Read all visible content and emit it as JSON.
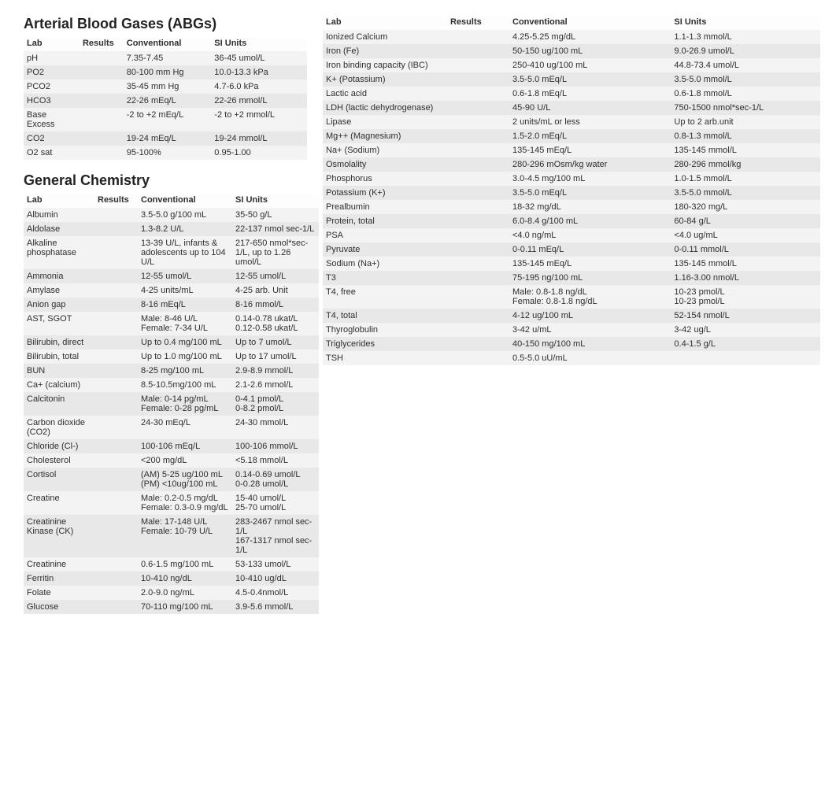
{
  "headers": {
    "lab": "Lab",
    "results": "Results",
    "conventional": "Conventional",
    "si": "SI Units"
  },
  "abg": {
    "title": "Arterial Blood Gases (ABGs)",
    "rows": [
      {
        "lab": "pH",
        "res": "",
        "conv": "7.35-7.45",
        "si": "36-45 umol/L"
      },
      {
        "lab": "PO2",
        "res": "",
        "conv": "80-100 mm Hg",
        "si": "10.0-13.3 kPa"
      },
      {
        "lab": "PCO2",
        "res": "",
        "conv": "35-45 mm Hg",
        "si": "4.7-6.0 kPa"
      },
      {
        "lab": "HCO3",
        "res": "",
        "conv": "22-26 mEq/L",
        "si": "22-26 mmol/L"
      },
      {
        "lab": "Base Excess",
        "res": "",
        "conv": "-2 to +2 mEq/L",
        "si": "-2 to +2 mmol/L"
      },
      {
        "lab": "CO2",
        "res": "",
        "conv": "19-24 mEq/L",
        "si": "19-24 mmol/L"
      },
      {
        "lab": "O2 sat",
        "res": "",
        "conv": "95-100%",
        "si": "0.95-1.00"
      }
    ]
  },
  "gc": {
    "title": "General Chemistry",
    "left_rows": [
      {
        "lab": "Albumin",
        "res": "",
        "conv": "3.5-5.0 g/100 mL",
        "si": "35-50 g/L"
      },
      {
        "lab": "Aldolase",
        "res": "",
        "conv": "1.3-8.2 U/L",
        "si": "22-137 nmol sec-1/L"
      },
      {
        "lab": "Alkaline phosphatase",
        "res": "",
        "conv": "13-39 U/L, infants & adolescents up to 104 U/L",
        "si": "217-650 nmol*sec-1/L, up to 1.26 umol/L"
      },
      {
        "lab": "Ammonia",
        "res": "",
        "conv": "12-55 umol/L",
        "si": "12-55 umol/L"
      },
      {
        "lab": "Amylase",
        "res": "",
        "conv": "4-25 units/mL",
        "si": "4-25 arb. Unit"
      },
      {
        "lab": "Anion gap",
        "res": "",
        "conv": "8-16 mEq/L",
        "si": "8-16 mmol/L"
      },
      {
        "lab": "AST, SGOT",
        "res": "",
        "conv": "Male: 8-46 U/L\nFemale: 7-34 U/L",
        "si": "0.14-0.78 ukat/L\n0.12-0.58 ukat/L"
      },
      {
        "lab": "Bilirubin, direct",
        "res": "",
        "conv": "Up to 0.4 mg/100 mL",
        "si": "Up to 7 umol/L"
      },
      {
        "lab": "Bilirubin, total",
        "res": "",
        "conv": "Up to 1.0 mg/100 mL",
        "si": "Up to 17 umol/L"
      },
      {
        "lab": "BUN",
        "res": "",
        "conv": "8-25 mg/100 mL",
        "si": "2.9-8.9 mmol/L"
      },
      {
        "lab": "Ca+ (calcium)",
        "res": "",
        "conv": "8.5-10.5mg/100 mL",
        "si": "2.1-2.6 mmol/L"
      },
      {
        "lab": "Calcitonin",
        "res": "",
        "conv": "Male: 0-14 pg/mL\nFemale: 0-28 pg/mL",
        "si": "0-4.1 pmol/L\n0-8.2 pmol/L"
      },
      {
        "lab": "Carbon dioxide (CO2)",
        "res": "",
        "conv": "24-30 mEq/L",
        "si": "24-30 mmol/L"
      },
      {
        "lab": "Chloride (Cl-)",
        "res": "",
        "conv": "100-106 mEq/L",
        "si": "100-106 mmol/L"
      },
      {
        "lab": "Cholesterol",
        "res": "",
        "conv": "<200 mg/dL",
        "si": "<5.18 mmol/L"
      },
      {
        "lab": "Cortisol",
        "res": "",
        "conv": "(AM) 5-25 ug/100 mL\n(PM) <10ug/100 mL",
        "si": "0.14-0.69 umol/L\n0-0.28 umol/L"
      },
      {
        "lab": "Creatine",
        "res": "",
        "conv": "Male: 0.2-0.5 mg/dL\nFemale: 0.3-0.9 mg/dL",
        "si": "15-40 umol/L\n25-70 umol/L"
      },
      {
        "lab": "Creatinine Kinase (CK)",
        "res": "",
        "conv": "Male: 17-148 U/L\nFemale: 10-79 U/L",
        "si": "283-2467 nmol sec-1/L\n167-1317 nmol sec-1/L"
      },
      {
        "lab": "Creatinine",
        "res": "",
        "conv": "0.6-1.5 mg/100 mL",
        "si": "53-133 umol/L"
      },
      {
        "lab": "Ferritin",
        "res": "",
        "conv": "10-410 ng/dL",
        "si": "10-410 ug/dL"
      },
      {
        "lab": "Folate",
        "res": "",
        "conv": "2.0-9.0 ng/mL",
        "si": "4.5-0.4nmol/L"
      },
      {
        "lab": "Glucose",
        "res": "",
        "conv": "70-110 mg/100 mL",
        "si": "3.9-5.6 mmol/L"
      }
    ],
    "right_rows": [
      {
        "lab": "Ionized Calcium",
        "res": "",
        "conv": "4.25-5.25 mg/dL",
        "si": "1.1-1.3 mmol/L"
      },
      {
        "lab": "Iron (Fe)",
        "res": "",
        "conv": "50-150 ug/100 mL",
        "si": "9.0-26.9 umol/L"
      },
      {
        "lab": "Iron binding capacity (IBC)",
        "res": "",
        "conv": "250-410 ug/100 mL",
        "si": "44.8-73.4 umol/L"
      },
      {
        "lab": "K+ (Potassium)",
        "res": "",
        "conv": "3.5-5.0 mEq/L",
        "si": "3.5-5.0 mmol/L"
      },
      {
        "lab": "Lactic acid",
        "res": "",
        "conv": "0.6-1.8 mEq/L",
        "si": "0.6-1.8 mmol/L"
      },
      {
        "lab": "LDH (lactic dehydrogenase)",
        "res": "",
        "conv": "45-90 U/L",
        "si": "750-1500 nmol*sec-1/L"
      },
      {
        "lab": "Lipase",
        "res": "",
        "conv": "2 units/mL or less",
        "si": "Up to 2 arb.unit"
      },
      {
        "lab": "Mg++ (Magnesium)",
        "res": "",
        "conv": "1.5-2.0 mEq/L",
        "si": "0.8-1.3 mmol/L"
      },
      {
        "lab": "Na+ (Sodium)",
        "res": "",
        "conv": "135-145 mEq/L",
        "si": "135-145 mmol/L"
      },
      {
        "lab": "Osmolality",
        "res": "",
        "conv": "280-296 mOsm/kg water",
        "si": "280-296 mmol/kg"
      },
      {
        "lab": "Phosphorus",
        "res": "",
        "conv": "3.0-4.5 mg/100 mL",
        "si": "1.0-1.5 mmol/L"
      },
      {
        "lab": "Potassium (K+)",
        "res": "",
        "conv": "3.5-5.0 mEq/L",
        "si": "3.5-5.0 mmol/L"
      },
      {
        "lab": "Prealbumin",
        "res": "",
        "conv": "18-32 mg/dL",
        "si": "180-320 mg/L"
      },
      {
        "lab": "Protein, total",
        "res": "",
        "conv": "6.0-8.4 g/100 mL",
        "si": "60-84 g/L"
      },
      {
        "lab": "PSA",
        "res": "",
        "conv": "<4.0 ng/mL",
        "si": "<4.0 ug/mL"
      },
      {
        "lab": "Pyruvate",
        "res": "",
        "conv": "0-0.11 mEq/L",
        "si": "0-0.11 mmol/L"
      },
      {
        "lab": "Sodium (Na+)",
        "res": "",
        "conv": "135-145 mEq/L",
        "si": "135-145 mmol/L"
      },
      {
        "lab": "T3",
        "res": "",
        "conv": "75-195 ng/100 mL",
        "si": "1.16-3.00 nmol/L"
      },
      {
        "lab": "T4, free",
        "res": "",
        "conv": "Male: 0.8-1.8 ng/dL\nFemale: 0.8-1.8 ng/dL",
        "si": "10-23 pmol/L\n10-23 pmol/L"
      },
      {
        "lab": "T4, total",
        "res": "",
        "conv": "4-12 ug/100 mL",
        "si": "52-154 nmol/L"
      },
      {
        "lab": "Thyroglobulin",
        "res": "",
        "conv": "3-42 u/mL",
        "si": "3-42 ug/L"
      },
      {
        "lab": "Triglycerides",
        "res": "",
        "conv": "40-150 mg/100 mL",
        "si": "0.4-1.5 g/L"
      },
      {
        "lab": "TSH",
        "res": "",
        "conv": "0.5-5.0 uU/mL",
        "si": ""
      }
    ]
  }
}
